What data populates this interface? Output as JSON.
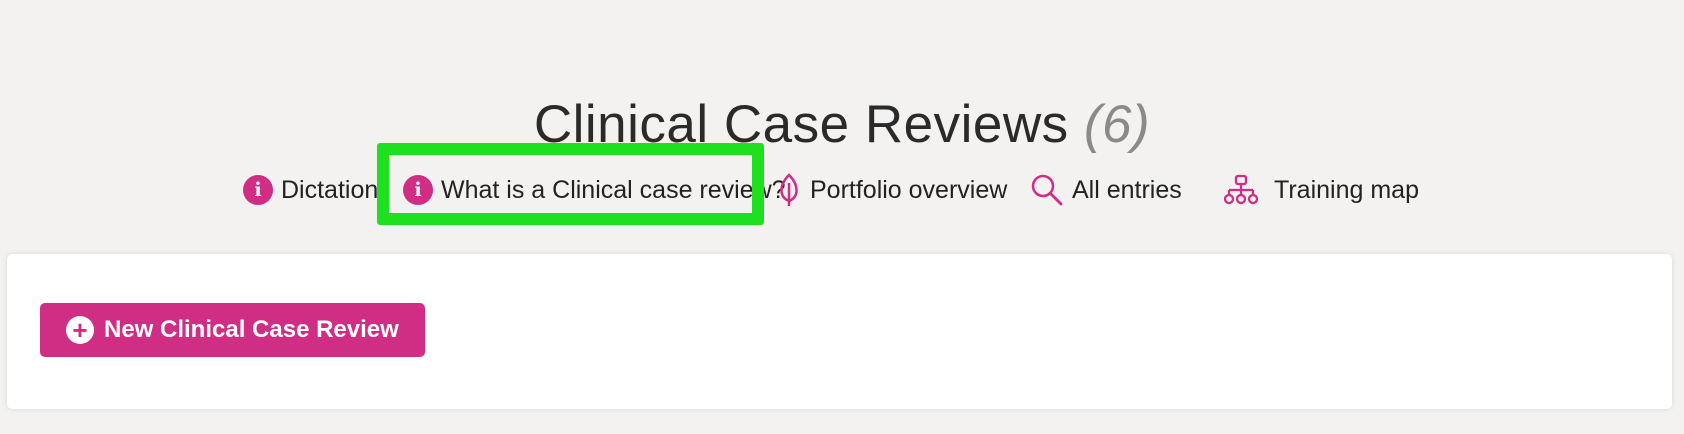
{
  "header": {
    "title": "Clinical Case Reviews",
    "count": "(6)"
  },
  "nav": {
    "items": [
      {
        "label": "Dictation",
        "icon": "info-icon"
      },
      {
        "label": "What is a Clinical case review?",
        "icon": "info-icon"
      },
      {
        "label": "Portfolio overview",
        "icon": "leaf-icon"
      },
      {
        "label": "All entries",
        "icon": "search-icon"
      },
      {
        "label": "Training map",
        "icon": "sitemap-icon"
      }
    ]
  },
  "main": {
    "new_button_label": "New Clinical Case Review"
  },
  "colors": {
    "accent": "#d02d84",
    "highlight": "#1ee01e",
    "background": "#f3f2f0"
  }
}
